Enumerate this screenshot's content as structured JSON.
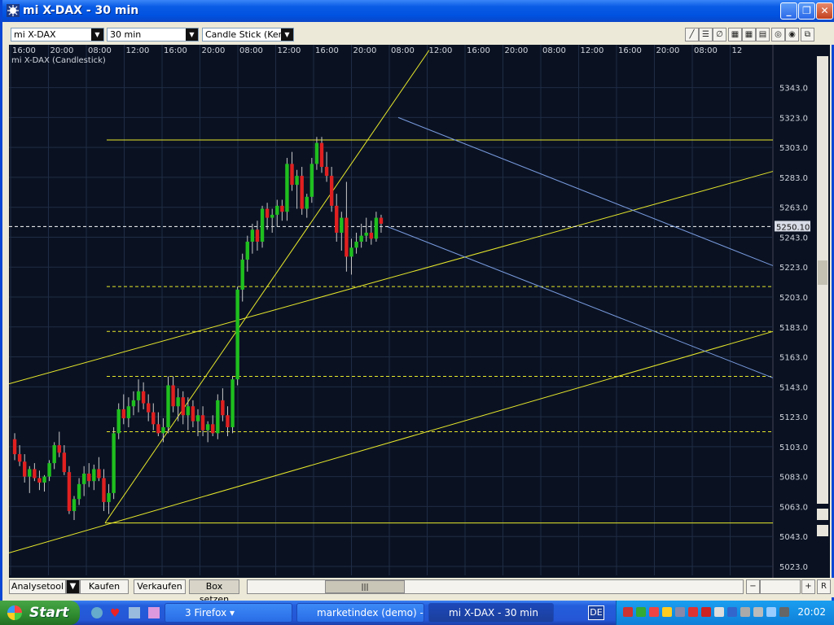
{
  "window": {
    "title": "mi X-DAX - 30 min"
  },
  "toolbar": {
    "symbol": "mi X-DAX",
    "interval": "30 min",
    "chart_type": "Candle Stick (Kerze"
  },
  "chart": {
    "label": "mi X-DAX (Candlestick)",
    "time_labels": [
      "16:00",
      "20:00",
      "08:00",
      "12:00",
      "16:00",
      "20:00",
      "08:00",
      "12:00",
      "16:00",
      "20:00",
      "08:00",
      "12:00",
      "16:00",
      "20:00",
      "08:00",
      "12:00",
      "16:00",
      "20:00",
      "08:00",
      "12"
    ],
    "price_labels": [
      "5343.0",
      "5323.0",
      "5303.0",
      "5283.0",
      "5263.0",
      "5243.0",
      "5223.0",
      "5203.0",
      "5183.0",
      "5163.0",
      "5143.0",
      "5123.0",
      "5103.0",
      "5083.0",
      "5063.0",
      "5043.0",
      "5023.0"
    ],
    "current_price": "5250.10",
    "colors": {
      "up": "#1fbf1f",
      "down": "#e02020",
      "trend": "#e8e82a",
      "channel": "#7a9ce0",
      "grid": "#1f2c44"
    }
  },
  "chart_data": {
    "type": "candlestick",
    "title": "mi X-DAX (Candlestick)",
    "ylim": [
      5017,
      5364
    ],
    "current": 5250.1,
    "candles": [
      [
        5108,
        5112,
        5094,
        5098
      ],
      [
        5098,
        5104,
        5090,
        5093
      ],
      [
        5093,
        5098,
        5079,
        5083
      ],
      [
        5083,
        5090,
        5072,
        5088
      ],
      [
        5088,
        5092,
        5080,
        5082
      ],
      [
        5082,
        5087,
        5074,
        5079
      ],
      [
        5079,
        5084,
        5073,
        5083
      ],
      [
        5083,
        5094,
        5080,
        5092
      ],
      [
        5092,
        5106,
        5088,
        5104
      ],
      [
        5104,
        5113,
        5096,
        5099
      ],
      [
        5099,
        5104,
        5084,
        5086
      ],
      [
        5086,
        5090,
        5058,
        5060
      ],
      [
        5060,
        5070,
        5054,
        5068
      ],
      [
        5068,
        5082,
        5064,
        5078
      ],
      [
        5078,
        5090,
        5070,
        5085
      ],
      [
        5085,
        5092,
        5076,
        5080
      ],
      [
        5080,
        5091,
        5074,
        5088
      ],
      [
        5088,
        5096,
        5080,
        5082
      ],
      [
        5082,
        5088,
        5060,
        5066
      ],
      [
        5066,
        5078,
        5058,
        5072
      ],
      [
        5072,
        5116,
        5068,
        5112
      ],
      [
        5112,
        5132,
        5108,
        5128
      ],
      [
        5128,
        5138,
        5118,
        5122
      ],
      [
        5122,
        5136,
        5116,
        5130
      ],
      [
        5130,
        5140,
        5124,
        5134
      ],
      [
        5134,
        5148,
        5126,
        5140
      ],
      [
        5140,
        5146,
        5128,
        5132
      ],
      [
        5132,
        5138,
        5120,
        5126
      ],
      [
        5126,
        5132,
        5114,
        5118
      ],
      [
        5118,
        5126,
        5110,
        5112
      ],
      [
        5112,
        5122,
        5106,
        5116
      ],
      [
        5116,
        5150,
        5112,
        5144
      ],
      [
        5144,
        5150,
        5126,
        5130
      ],
      [
        5130,
        5142,
        5120,
        5136
      ],
      [
        5136,
        5140,
        5118,
        5124
      ],
      [
        5124,
        5136,
        5114,
        5130
      ],
      [
        5130,
        5134,
        5116,
        5120
      ],
      [
        5120,
        5128,
        5110,
        5124
      ],
      [
        5124,
        5130,
        5110,
        5114
      ],
      [
        5114,
        5120,
        5106,
        5118
      ],
      [
        5118,
        5124,
        5110,
        5112
      ],
      [
        5112,
        5138,
        5108,
        5134
      ],
      [
        5134,
        5142,
        5120,
        5124
      ],
      [
        5124,
        5130,
        5110,
        5116
      ],
      [
        5116,
        5150,
        5112,
        5148
      ],
      [
        5148,
        5210,
        5144,
        5208
      ],
      [
        5208,
        5232,
        5200,
        5228
      ],
      [
        5228,
        5244,
        5220,
        5240
      ],
      [
        5240,
        5252,
        5232,
        5248
      ],
      [
        5248,
        5254,
        5234,
        5240
      ],
      [
        5240,
        5264,
        5236,
        5262
      ],
      [
        5262,
        5266,
        5248,
        5256
      ],
      [
        5256,
        5262,
        5246,
        5258
      ],
      [
        5258,
        5268,
        5250,
        5264
      ],
      [
        5264,
        5268,
        5254,
        5260
      ],
      [
        5260,
        5296,
        5254,
        5292
      ],
      [
        5292,
        5300,
        5274,
        5278
      ],
      [
        5278,
        5288,
        5262,
        5284
      ],
      [
        5284,
        5290,
        5258,
        5262
      ],
      [
        5262,
        5272,
        5256,
        5270
      ],
      [
        5270,
        5296,
        5266,
        5292
      ],
      [
        5292,
        5310,
        5288,
        5306
      ],
      [
        5306,
        5310,
        5286,
        5290
      ],
      [
        5290,
        5300,
        5280,
        5284
      ],
      [
        5284,
        5290,
        5260,
        5264
      ],
      [
        5264,
        5272,
        5240,
        5246
      ],
      [
        5246,
        5260,
        5234,
        5256
      ],
      [
        5256,
        5280,
        5220,
        5230
      ],
      [
        5230,
        5242,
        5218,
        5236
      ],
      [
        5236,
        5246,
        5232,
        5240
      ],
      [
        5240,
        5252,
        5236,
        5244
      ],
      [
        5244,
        5256,
        5240,
        5246
      ],
      [
        5246,
        5254,
        5238,
        5242
      ],
      [
        5242,
        5260,
        5240,
        5256
      ],
      [
        5256,
        5258,
        5246,
        5252
      ]
    ]
  }
}
